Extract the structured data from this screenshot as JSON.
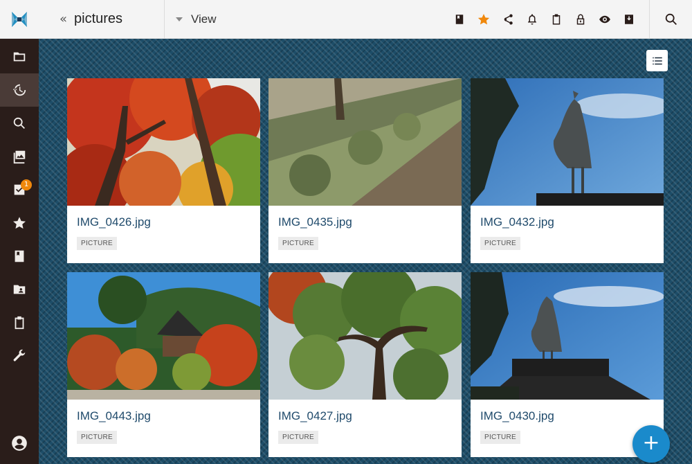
{
  "header": {
    "collapse_glyph": "«",
    "title": "pictures",
    "view_label": "View"
  },
  "sidebar": {
    "items": [
      {
        "icon": "folder-icon",
        "active": false
      },
      {
        "icon": "history-icon",
        "active": true
      },
      {
        "icon": "search-icon",
        "active": false
      },
      {
        "icon": "gallery-icon",
        "active": false
      },
      {
        "icon": "tasks-icon",
        "active": false,
        "badge": "1"
      },
      {
        "icon": "star-icon",
        "active": false
      },
      {
        "icon": "book-icon",
        "active": false
      },
      {
        "icon": "shared-folder-icon",
        "active": false
      },
      {
        "icon": "clipboard-icon",
        "active": false
      },
      {
        "icon": "wrench-icon",
        "active": false
      }
    ],
    "account_icon": "account-icon"
  },
  "toolbar": {
    "icons": [
      "book-icon",
      "star-icon",
      "share-icon",
      "bell-icon",
      "clipboard-icon",
      "lock-icon",
      "eye-icon",
      "archive-icon"
    ],
    "search_icon": "search-icon"
  },
  "cards": [
    {
      "name": "IMG_0426.jpg",
      "tag": "PICTURE"
    },
    {
      "name": "IMG_0435.jpg",
      "tag": "PICTURE"
    },
    {
      "name": "IMG_0432.jpg",
      "tag": "PICTURE"
    },
    {
      "name": "IMG_0443.jpg",
      "tag": "PICTURE"
    },
    {
      "name": "IMG_0427.jpg",
      "tag": "PICTURE"
    },
    {
      "name": "IMG_0430.jpg",
      "tag": "PICTURE"
    }
  ],
  "fab": {
    "label": "+"
  },
  "colors": {
    "sidebar": "#2a1d1a",
    "accent_orange": "#f0880c",
    "fab_blue": "#1a8acb",
    "background": "#1d4d68",
    "filename": "#1f4a6b"
  }
}
